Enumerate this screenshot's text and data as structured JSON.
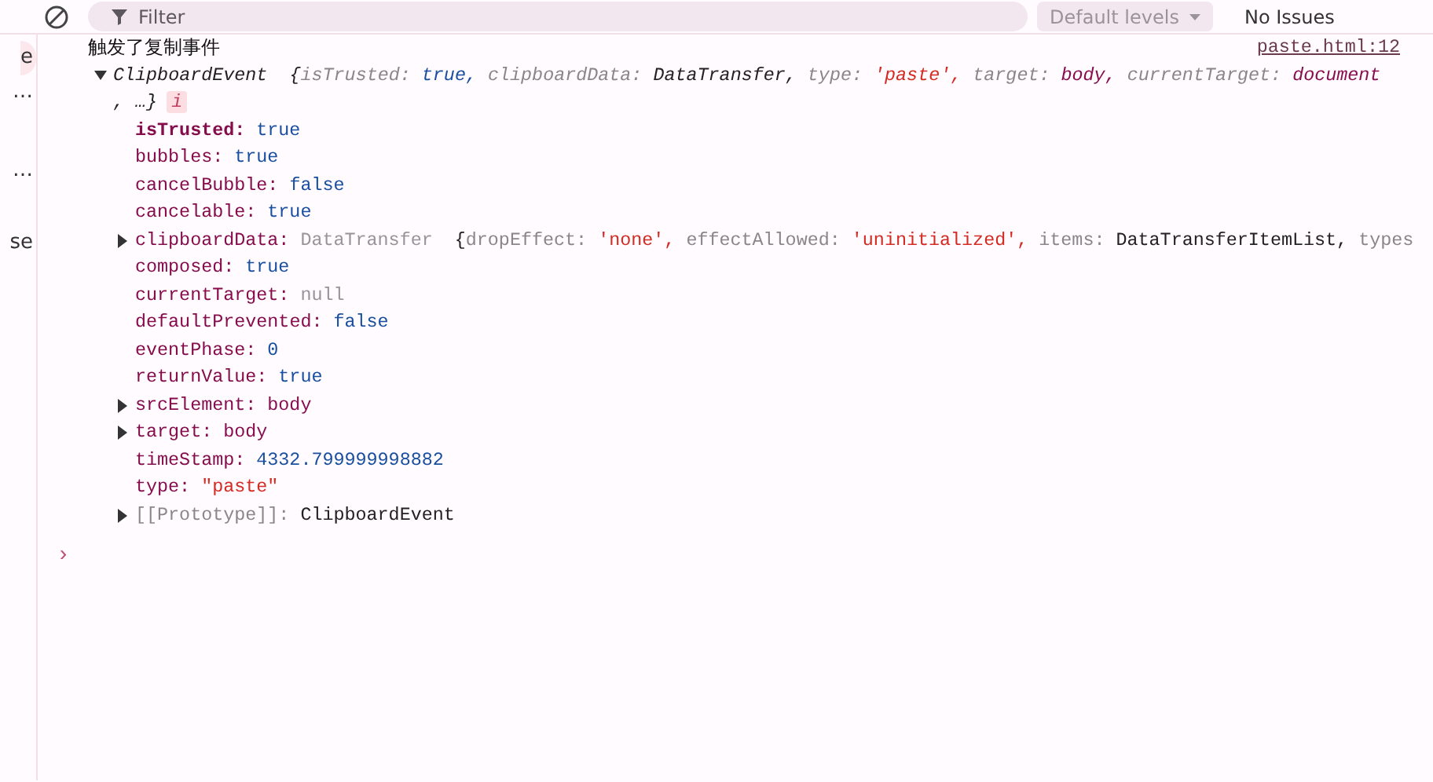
{
  "toolbar": {
    "filter": {
      "placeholder": "Filter"
    },
    "levels": "Default levels",
    "issues": "No Issues"
  },
  "sidebar": {
    "items": [
      {
        "label": "e",
        "selected": true
      },
      {
        "label": "…",
        "selected": false
      },
      {
        "label": "…",
        "selected": false
      },
      {
        "label": "se",
        "selected": false
      }
    ]
  },
  "log": {
    "message": "触发了复制事件",
    "source": "paste.html:12",
    "object": {
      "expanded": true,
      "class_name": "ClipboardEvent",
      "open": "{",
      "preview": [
        {
          "key": "isTrusted:",
          "value": "true,",
          "kind": "bool"
        },
        {
          "key": "clipboardData:",
          "value": "DataTransfer,",
          "kind": "object"
        },
        {
          "key": "type:",
          "value": "'paste',",
          "kind": "string"
        },
        {
          "key": "target:",
          "value": "body,",
          "kind": "node"
        },
        {
          "key": "currentTarget:",
          "value": "document",
          "kind": "node"
        }
      ],
      "tail": ", …}",
      "badge": "i",
      "properties": [
        {
          "key": "isTrusted:",
          "value": "true",
          "kind": "bool",
          "expandable": false,
          "own": true
        },
        {
          "key": "bubbles:",
          "value": "true",
          "kind": "bool",
          "expandable": false,
          "own": false
        },
        {
          "key": "cancelBubble:",
          "value": "false",
          "kind": "bool",
          "expandable": false,
          "own": false
        },
        {
          "key": "cancelable:",
          "value": "true",
          "kind": "bool",
          "expandable": false,
          "own": false
        },
        {
          "key": "clipboardData:",
          "value": "DataTransfer",
          "kind": "object",
          "expandable": true,
          "own": false,
          "open": "{",
          "preview": [
            {
              "key": "dropEffect:",
              "value": "'none',",
              "kind": "string"
            },
            {
              "key": "effectAllowed:",
              "value": "'uninitialized',",
              "kind": "string"
            },
            {
              "key": "items:",
              "value": "DataTransferItemList,",
              "kind": "plain"
            },
            {
              "key": "types"
            }
          ]
        },
        {
          "key": "composed:",
          "value": "true",
          "kind": "bool",
          "expandable": false,
          "own": false
        },
        {
          "key": "currentTarget:",
          "value": "null",
          "kind": "null",
          "expandable": false,
          "own": false
        },
        {
          "key": "defaultPrevented:",
          "value": "false",
          "kind": "bool",
          "expandable": false,
          "own": false
        },
        {
          "key": "eventPhase:",
          "value": "0",
          "kind": "number",
          "expandable": false,
          "own": false
        },
        {
          "key": "returnValue:",
          "value": "true",
          "kind": "bool",
          "expandable": false,
          "own": false
        },
        {
          "key": "srcElement:",
          "value": "body",
          "kind": "node",
          "expandable": true,
          "own": false
        },
        {
          "key": "target:",
          "value": "body",
          "kind": "node",
          "expandable": true,
          "own": false
        },
        {
          "key": "timeStamp:",
          "value": "4332.799999998882",
          "kind": "number",
          "expandable": false,
          "own": false
        },
        {
          "key": "type:",
          "value": "\"paste\"",
          "kind": "string",
          "expandable": false,
          "own": false
        },
        {
          "key": "[[Prototype]]:",
          "value": "ClipboardEvent",
          "kind": "plain",
          "expandable": true,
          "own": false,
          "internal": true
        }
      ]
    }
  },
  "prompt": "›"
}
